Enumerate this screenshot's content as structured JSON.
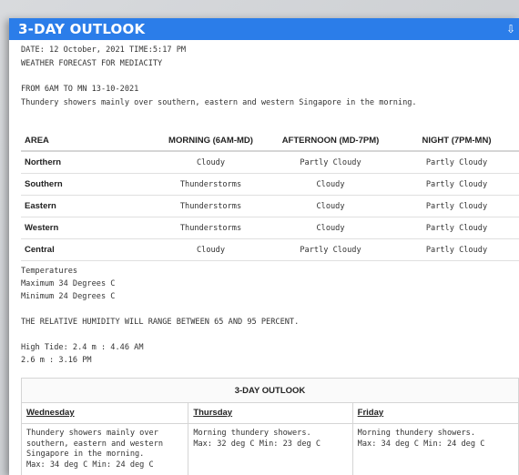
{
  "header": {
    "title": "3-DAY OUTLOOK",
    "download_icon": "download-icon"
  },
  "meta": {
    "date_line": "DATE: 12 October, 2021 TIME:5:17 PM",
    "subtitle": "WEATHER FORECAST FOR MEDIACITY"
  },
  "period": {
    "range": "FROM 6AM TO MN 13-10-2021",
    "summary": "Thundery showers mainly over southern, eastern and western Singapore in the morning."
  },
  "forecast_table": {
    "headers": [
      "AREA",
      "MORNING (6AM-MD)",
      "AFTERNOON (MD-7PM)",
      "NIGHT (7PM-MN)"
    ],
    "rows": [
      {
        "area": "Northern",
        "morning": "Cloudy",
        "afternoon": "Partly Cloudy",
        "night": "Partly Cloudy"
      },
      {
        "area": "Southern",
        "morning": "Thunderstorms",
        "afternoon": "Cloudy",
        "night": "Partly Cloudy"
      },
      {
        "area": "Eastern",
        "morning": "Thunderstorms",
        "afternoon": "Cloudy",
        "night": "Partly Cloudy"
      },
      {
        "area": "Western",
        "morning": "Thunderstorms",
        "afternoon": "Cloudy",
        "night": "Partly Cloudy"
      },
      {
        "area": "Central",
        "morning": "Cloudy",
        "afternoon": "Partly Cloudy",
        "night": "Partly Cloudy"
      }
    ]
  },
  "temperatures": {
    "heading": "Temperatures",
    "max": "Maximum 34 Degrees C",
    "min": "Minimum 24 Degrees C"
  },
  "humidity": "THE RELATIVE HUMIDITY WILL RANGE BETWEEN 65 AND 95 PERCENT.",
  "tide": {
    "high": "High Tide: 2.4 m : 4.46 AM",
    "second": "2.6 m : 3.16 PM"
  },
  "outlook": {
    "title": "3-DAY OUTLOOK",
    "days": [
      {
        "day": "Wednesday",
        "lines": [
          "Thundery showers mainly over",
          "southern, eastern and western",
          "Singapore in the morning.",
          "Max: 34 deg C Min: 24 deg C"
        ]
      },
      {
        "day": "Thursday",
        "lines": [
          "Morning thundery showers.",
          "Max: 32 deg C Min: 23 deg C"
        ]
      },
      {
        "day": "Friday",
        "lines": [
          "Morning thundery showers.",
          "Max: 34 deg C Min: 24 deg C"
        ]
      }
    ]
  }
}
